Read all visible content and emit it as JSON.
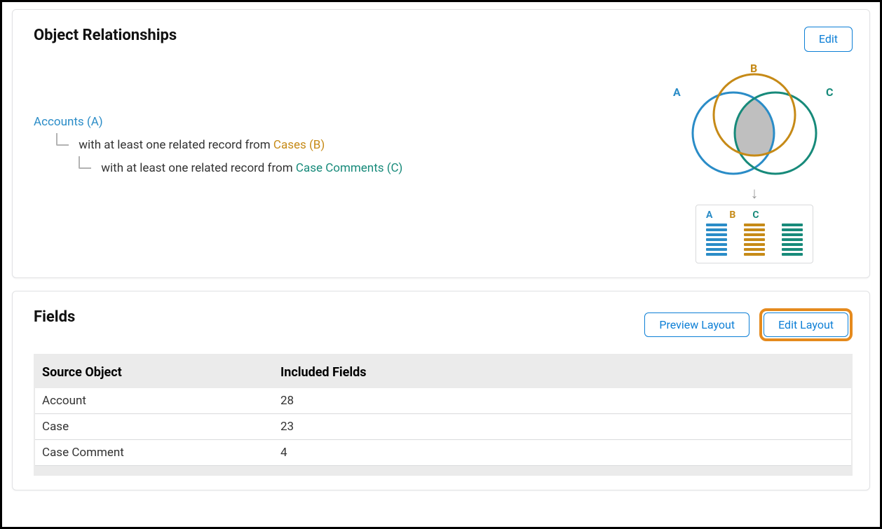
{
  "relationships": {
    "title": "Object Relationships",
    "edit_label": "Edit",
    "tree": {
      "root": "Accounts (A)",
      "lvl1_prefix": "with at least one related record from ",
      "lvl1_link": "Cases (B)",
      "lvl2_prefix": "with at least one related record from ",
      "lvl2_link": "Case Comments (C)"
    },
    "diagram": {
      "label_a": "A",
      "label_b": "B",
      "label_c": "C",
      "mini_a": "A",
      "mini_b": "B",
      "mini_c": "C"
    }
  },
  "fields": {
    "title": "Fields",
    "preview_label": "Preview Layout",
    "edit_layout_label": "Edit Layout",
    "col_source": "Source Object",
    "col_included": "Included Fields",
    "rows": [
      {
        "source": "Account",
        "included": "28"
      },
      {
        "source": "Case",
        "included": "23"
      },
      {
        "source": "Case Comment",
        "included": "4"
      }
    ]
  }
}
